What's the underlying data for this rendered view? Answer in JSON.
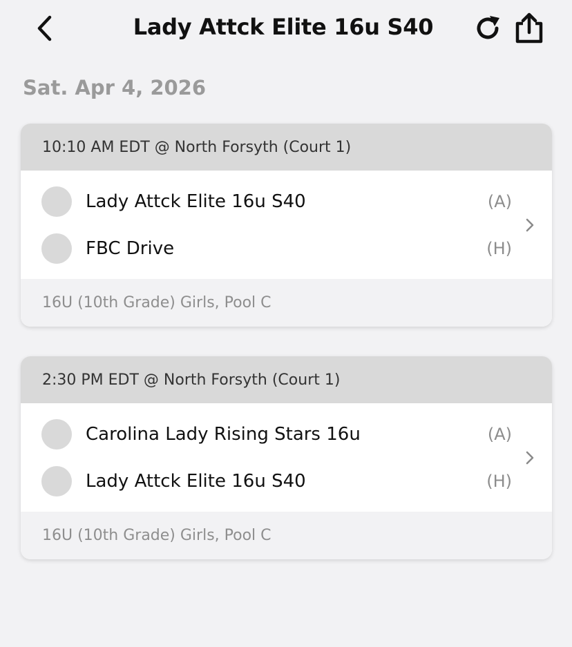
{
  "header": {
    "title": "Lady Attck Elite 16u S40",
    "back_icon": "chevron-left-icon",
    "refresh_icon": "refresh-icon",
    "share_icon": "share-icon"
  },
  "date": "Sat. Apr 4, 2026",
  "matches": [
    {
      "time_location": "10:10 AM EDT @ North Forsyth (Court 1)",
      "away": {
        "name": "Lady Attck Elite 16u S40",
        "side": "(A)"
      },
      "home": {
        "name": "FBC Drive",
        "side": "(H)"
      },
      "division": "16U (10th Grade) Girls, Pool C"
    },
    {
      "time_location": "2:30 PM EDT @ North Forsyth (Court 1)",
      "away": {
        "name": "Carolina Lady Rising Stars 16u",
        "side": "(A)"
      },
      "home": {
        "name": "Lady Attck Elite 16u S40",
        "side": "(H)"
      },
      "division": "16U (10th Grade) Girls, Pool C"
    }
  ],
  "colors": {
    "background": "#f2f2f4",
    "card_header": "#d9d9d9",
    "avatar_placeholder": "#d9d9d9",
    "date_text": "#9a9a9a"
  }
}
